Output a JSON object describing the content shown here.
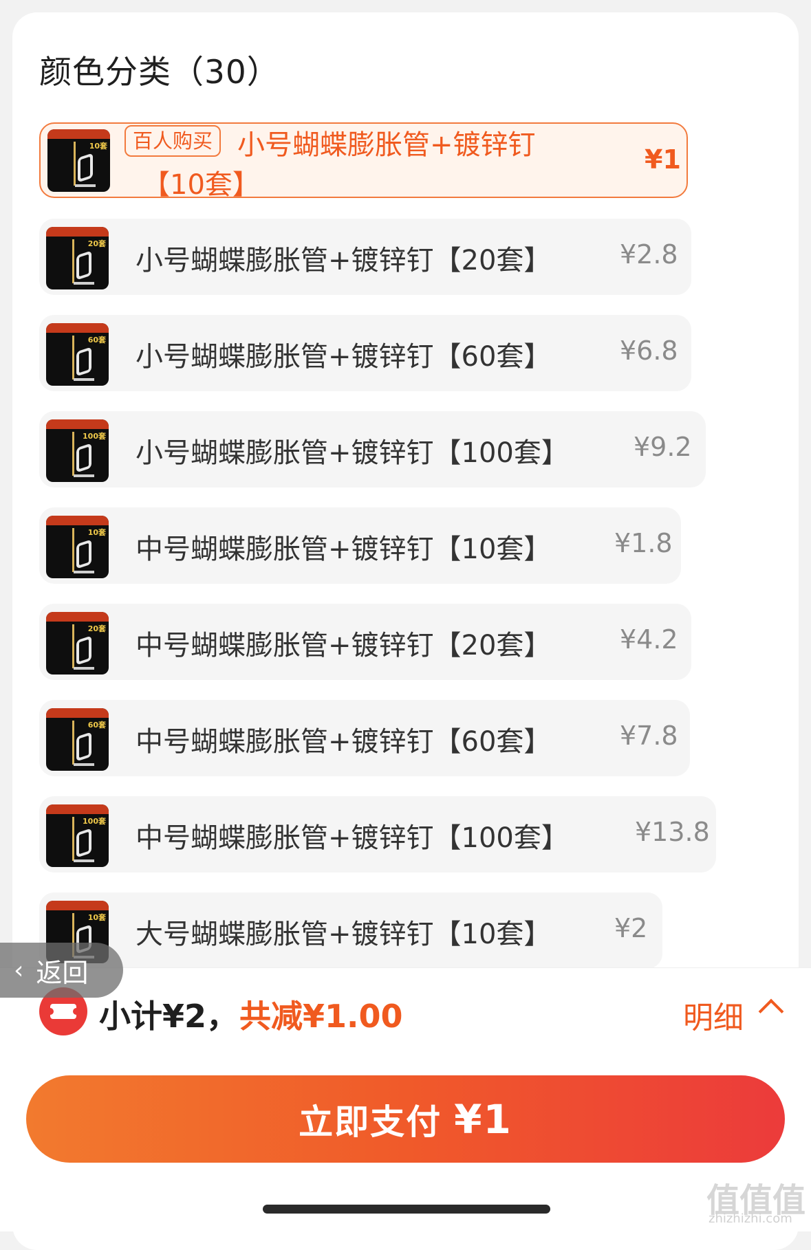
{
  "section": {
    "title": "颜色分类（30）"
  },
  "options": [
    {
      "badge": "百人购买",
      "label_line1": "小号蝴蝶膨胀管+镀锌钉",
      "label_line2": "【10套】",
      "price": "¥1",
      "thumb_qty": "10套",
      "selected": true
    },
    {
      "label": "小号蝴蝶膨胀管+镀锌钉【20套】",
      "price": "¥2.8",
      "thumb_qty": "20套"
    },
    {
      "label": "小号蝴蝶膨胀管+镀锌钉【60套】",
      "price": "¥6.8",
      "thumb_qty": "60套"
    },
    {
      "label": "小号蝴蝶膨胀管+镀锌钉【100套】",
      "price": "¥9.2",
      "thumb_qty": "100套"
    },
    {
      "label": "中号蝴蝶膨胀管+镀锌钉【10套】",
      "price": "¥1.8",
      "thumb_qty": "10套"
    },
    {
      "label": "中号蝴蝶膨胀管+镀锌钉【20套】",
      "price": "¥4.2",
      "thumb_qty": "20套"
    },
    {
      "label": "中号蝴蝶膨胀管+镀锌钉【60套】",
      "price": "¥7.8",
      "thumb_qty": "60套"
    },
    {
      "label": "中号蝴蝶膨胀管+镀锌钉【100套】",
      "price": "¥13.8",
      "thumb_qty": "100套"
    },
    {
      "label": "大号蝴蝶膨胀管+镀锌钉【10套】",
      "price": "¥2",
      "thumb_qty": "10套"
    }
  ],
  "back": {
    "label": "返回"
  },
  "summary": {
    "subtotal": "小计¥2，",
    "discount": "共减¥1.00",
    "detail": "明细"
  },
  "pay_button": {
    "label": "立即支付",
    "amount": "¥1"
  },
  "watermark": {
    "logo": "值值值",
    "site": "zhizhizhi.com"
  },
  "colors": {
    "accent": "#f05a1f",
    "coupon": "#ea3a37",
    "button_start": "#f27a2e",
    "button_end": "#ec3b3b"
  }
}
